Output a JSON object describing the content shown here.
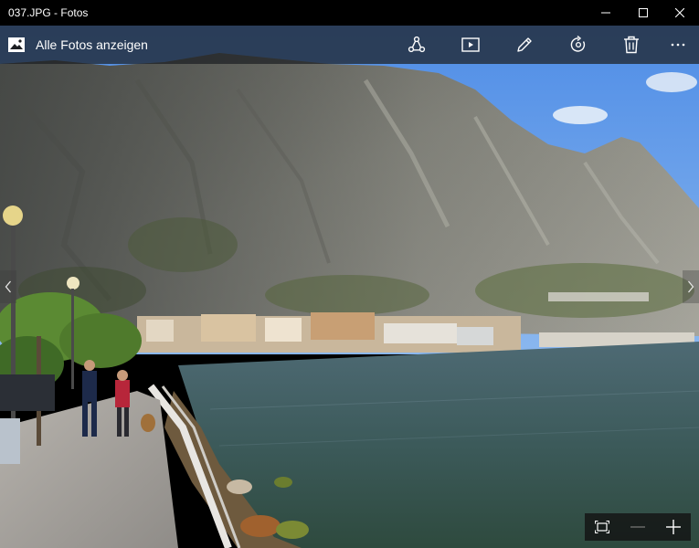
{
  "window": {
    "title": "037.JPG - Fotos"
  },
  "titlebar": {
    "minimize_icon": "minimize-icon",
    "maximize_icon": "maximize-icon",
    "close_icon": "close-icon"
  },
  "commandbar": {
    "back_label": "Alle Fotos anzeigen",
    "back_icon": "photos-gallery-icon",
    "actions": [
      {
        "id": "share",
        "icon": "share-icon"
      },
      {
        "id": "slideshow",
        "icon": "slideshow-icon"
      },
      {
        "id": "edit",
        "icon": "pencil-icon"
      },
      {
        "id": "rotate",
        "icon": "rotate-icon"
      },
      {
        "id": "delete",
        "icon": "trash-icon"
      },
      {
        "id": "more",
        "icon": "more-icon"
      }
    ]
  },
  "navigation": {
    "prev_icon": "chevron-left-icon",
    "next_icon": "chevron-right-icon"
  },
  "zoom": {
    "fit_icon": "fit-to-window-icon",
    "zoom_out_icon": "minus-icon",
    "zoom_in_icon": "plus-icon",
    "zoom_out_enabled": false
  },
  "colors": {
    "titlebar_bg": "#000000",
    "commandbar_bg": "#1c1e22",
    "icon_color": "#ffffff",
    "disabled_icon_color": "#6e6e6e"
  },
  "photo": {
    "subject": "Lakeside promenade with steep mountain and town under blue sky"
  }
}
